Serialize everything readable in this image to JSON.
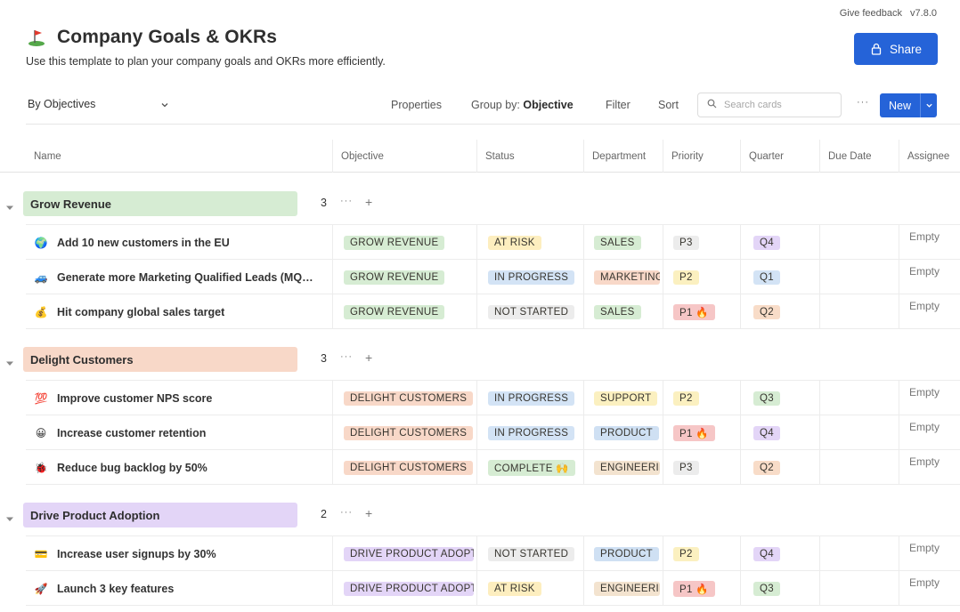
{
  "topmeta": {
    "feedback": "Give feedback",
    "version": "v7.8.0"
  },
  "page": {
    "title": "Company Goals & OKRs",
    "subtitle": "Use this template to plan your company goals and OKRs more efficiently.",
    "title_icon": "golf-flag-icon",
    "share_label": "Share"
  },
  "toolbar": {
    "view": "By Objectives",
    "properties": "Properties",
    "group_by_label": "Group by:",
    "group_by_value": "Objective",
    "filter": "Filter",
    "sort": "Sort",
    "search_placeholder": "Search cards",
    "more": "···",
    "new_label": "New"
  },
  "columns": [
    "Name",
    "Objective",
    "Status",
    "Department",
    "Priority",
    "Quarter",
    "Due Date",
    "Assignee"
  ],
  "colors": {
    "accent": "#2563d8",
    "grow_revenue": "#d6ecd3",
    "delight_customers": "#f8d8c8",
    "drive_adoption": "#e3d5f7"
  },
  "groups": [
    {
      "label": "Grow Revenue",
      "count": "3",
      "color": "#d6ecd3",
      "rows": [
        {
          "icon": "globe-icon",
          "emoji": "🌍",
          "name": "Add 10 new customers in the EU",
          "objective": "GROW REVENUE",
          "status": "AT RISK",
          "department": "SALES",
          "priority": "P3",
          "quarter": "Q4",
          "due": "",
          "assignee": "Empty"
        },
        {
          "icon": "car-icon",
          "emoji": "🚙",
          "name": "Generate more Marketing Qualified Leads (MQ…",
          "objective": "GROW REVENUE",
          "status": "IN PROGRESS",
          "department": "MARKETING",
          "priority": "P2",
          "quarter": "Q1",
          "due": "",
          "assignee": "Empty"
        },
        {
          "icon": "money-bag-icon",
          "emoji": "💰",
          "name": "Hit company global sales target",
          "objective": "GROW REVENUE",
          "status": "NOT STARTED",
          "department": "SALES",
          "priority": "P1 🔥",
          "quarter": "Q2",
          "due": "",
          "assignee": "Empty"
        }
      ]
    },
    {
      "label": "Delight Customers",
      "count": "3",
      "color": "#f8d8c8",
      "rows": [
        {
          "icon": "hundred-points-icon",
          "emoji": "💯",
          "name": "Improve customer NPS score",
          "objective": "DELIGHT CUSTOMERS",
          "status": "IN PROGRESS",
          "department": "SUPPORT",
          "priority": "P2",
          "quarter": "Q3",
          "due": "",
          "assignee": "Empty"
        },
        {
          "icon": "smiley-icon",
          "emoji": "😀",
          "name": "Increase customer retention",
          "objective": "DELIGHT CUSTOMERS",
          "status": "IN PROGRESS",
          "department": "PRODUCT",
          "priority": "P1 🔥",
          "quarter": "Q4",
          "due": "",
          "assignee": "Empty"
        },
        {
          "icon": "ladybug-icon",
          "emoji": "🐞",
          "name": "Reduce bug backlog by 50%",
          "objective": "DELIGHT CUSTOMERS",
          "status": "COMPLETE 🙌",
          "department": "ENGINEERING",
          "priority": "P3",
          "quarter": "Q2",
          "due": "",
          "assignee": "Empty"
        }
      ]
    },
    {
      "label": "Drive Product Adoption",
      "count": "2",
      "color": "#e3d5f7",
      "rows": [
        {
          "icon": "credit-card-icon",
          "emoji": "💳",
          "name": "Increase user signups by 30%",
          "objective": "DRIVE PRODUCT ADOPTION",
          "status": "NOT STARTED",
          "department": "PRODUCT",
          "priority": "P2",
          "quarter": "Q4",
          "due": "",
          "assignee": "Empty"
        },
        {
          "icon": "rocket-icon",
          "emoji": "🚀",
          "name": "Launch 3 key features",
          "objective": "DRIVE PRODUCT ADOPTION",
          "status": "AT RISK",
          "department": "ENGINEERING",
          "priority": "P1 🔥",
          "quarter": "Q3",
          "due": "",
          "assignee": "Empty"
        }
      ]
    }
  ],
  "tag_colors": {
    "objective": {
      "GROW REVENUE": "#d6ecd3",
      "DELIGHT CUSTOMERS": "#f8d8c8",
      "DRIVE PRODUCT ADOPTION": "#e3d5f7"
    },
    "status": {
      "AT RISK": "#fdeebf",
      "IN PROGRESS": "#d3e3f5",
      "NOT STARTED": "#ececec",
      "COMPLETE 🙌": "#d6ecd3"
    },
    "department": {
      "SALES": "#d6ecd3",
      "MARKETING": "#f8d8c8",
      "SUPPORT": "#fbf0c0",
      "PRODUCT": "#cfe0f3",
      "ENGINEERING": "#f3e3cf"
    },
    "priority": {
      "P1 🔥": "#f6c6c6",
      "P2": "#fbf0c0",
      "P3": "#ececec"
    },
    "quarter": {
      "Q1": "#d3e3f5",
      "Q2": "#f8dcc8",
      "Q3": "#d6ecd3",
      "Q4": "#e3d5f7"
    }
  }
}
